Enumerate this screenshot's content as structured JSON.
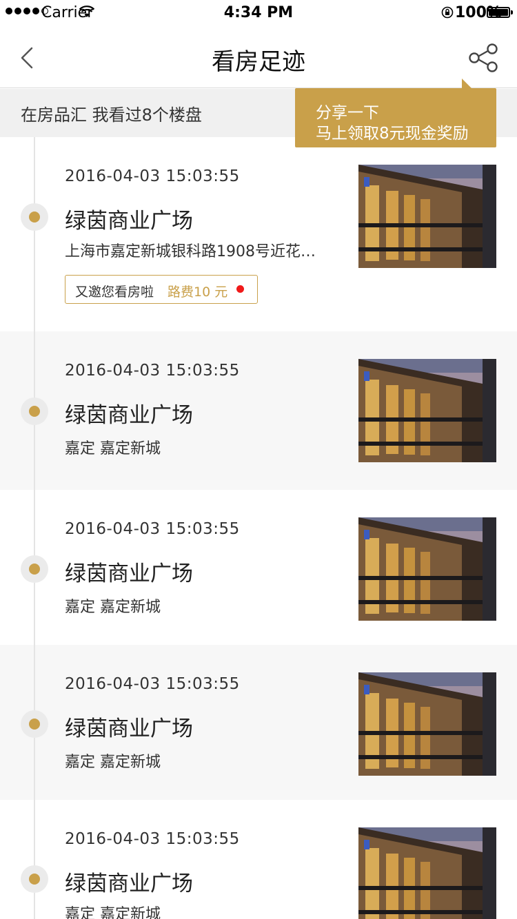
{
  "status_bar": {
    "carrier": "Carrier",
    "time": "4:34 PM",
    "battery": "100%"
  },
  "nav": {
    "title": "看房足迹",
    "back_icon": "chevron-left-icon",
    "share_icon": "share-icon"
  },
  "summary": {
    "text": "在房品汇  我看过8个楼盘"
  },
  "tooltip": {
    "line1": "分享一下",
    "line2": "马上领取8元现金奖励"
  },
  "colors": {
    "accent": "#c9a04a",
    "alt_row": "#f7f7f7",
    "red_dot": "#f01a1a"
  },
  "items": [
    {
      "date": "2016-04-03 15:03:55",
      "name": "绿茵商业广场",
      "address": "上海市嘉定新城银科路1908号近花…",
      "tag": {
        "text": "又邀您看房啦",
        "fee": "路费10 元"
      }
    },
    {
      "date": "2016-04-03 15:03:55",
      "name": "绿茵商业广场",
      "address": "嘉定  嘉定新城"
    },
    {
      "date": "2016-04-03 15:03:55",
      "name": "绿茵商业广场",
      "address": "嘉定  嘉定新城"
    },
    {
      "date": "2016-04-03 15:03:55",
      "name": "绿茵商业广场",
      "address": "嘉定  嘉定新城"
    },
    {
      "date": "2016-04-03 15:03:55",
      "name": "绿茵商业广场",
      "address": "嘉定  嘉定新城"
    }
  ]
}
